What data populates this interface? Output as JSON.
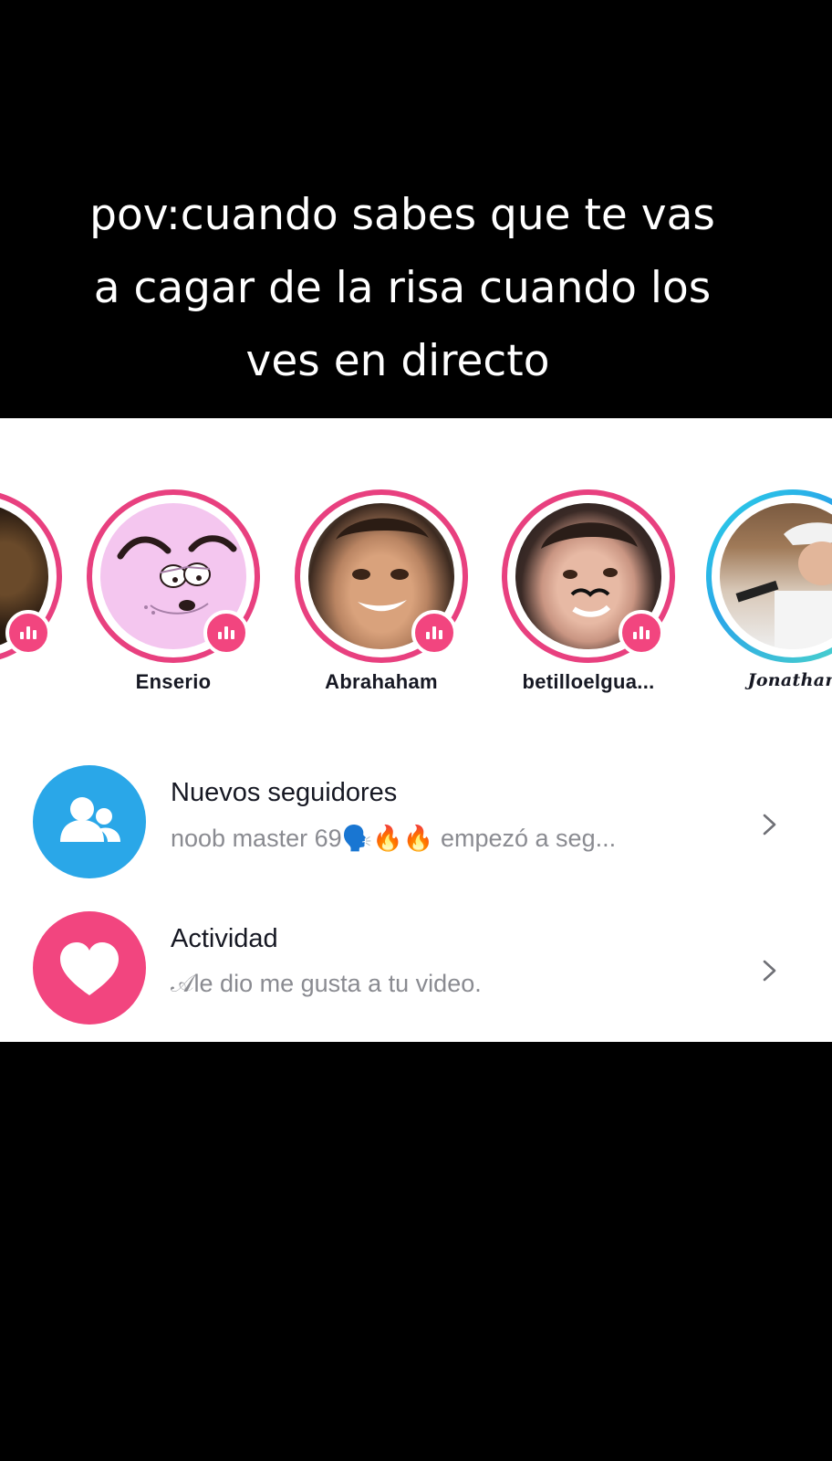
{
  "caption": {
    "line1": "pov:cuando sabes que te vas",
    "line2": "a cagar de la risa cuando los",
    "line3": "ves en directo"
  },
  "stories": [
    {
      "name": "",
      "ring": "pink"
    },
    {
      "name": "Enserio",
      "ring": "pink"
    },
    {
      "name": "Abrahaham",
      "ring": "pink"
    },
    {
      "name": "betilloelgua...",
      "ring": "pink"
    },
    {
      "name": "Jonathan",
      "ring": "blue"
    }
  ],
  "rows": {
    "followers": {
      "title": "Nuevos seguidores",
      "subtitle": "noob master 69🗣️🔥🔥 empezó a seg...",
      "icon": "people-icon",
      "color": "#2aa7e8"
    },
    "activity": {
      "title": "Actividad",
      "subtitle": "𝒜le dio me gusta a tu video.",
      "icon": "heart-icon",
      "color": "#f2457f"
    }
  },
  "colors": {
    "live_ring": "#e8407f",
    "background": "#000000",
    "panel": "#ffffff"
  }
}
